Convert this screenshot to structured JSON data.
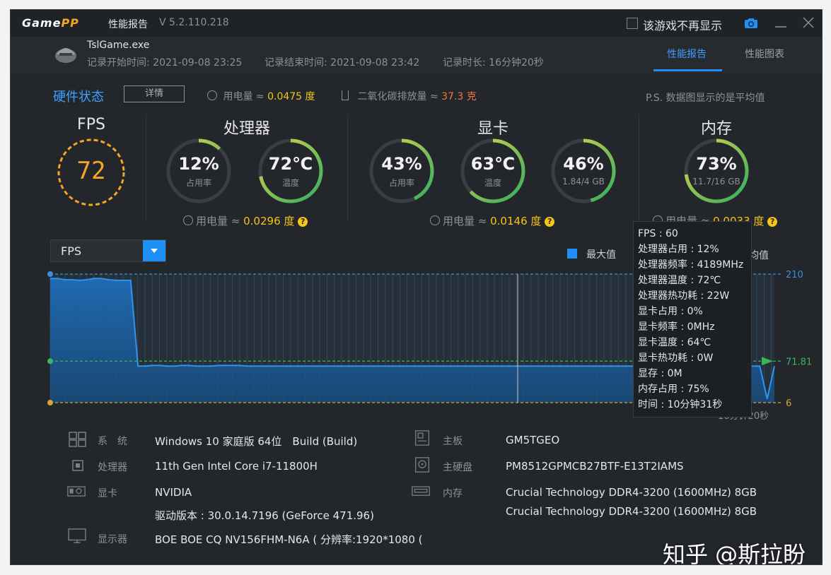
{
  "titlebar": {
    "logo_main": "Game",
    "logo_accent": "PP",
    "title": "性能报告",
    "version": "V 5.2.110.218",
    "no_show_label": "该游戏不再显示"
  },
  "session": {
    "game": "TslGame.exe",
    "start": "记录开始时间: 2021-09-08 23:25",
    "end": "记录结束时间: 2021-09-08 23:42",
    "duration": "记录时长: 16分钟20秒"
  },
  "tabs": [
    "性能报告",
    "性能图表"
  ],
  "hardware": {
    "title": "硬件状态",
    "detail_button": "详情",
    "power_label": "用电量 ≈",
    "power_value": "0.0475 度",
    "co2_label": "二氧化碳排放量 ≈",
    "co2_value": "37.3 克",
    "note": "P.S. 数据图显示的是平均值"
  },
  "sections": {
    "fps": {
      "title": "FPS",
      "value": "72"
    },
    "cpu": {
      "title": "处理器",
      "usage": {
        "value": "12%",
        "label": "占用率",
        "fraction": 0.12
      },
      "temp": {
        "value": "72℃",
        "label": "温度",
        "fraction": 0.72
      },
      "power_label": "用电量 ≈",
      "power_value": "0.0296 度"
    },
    "gpu": {
      "title": "显卡",
      "usage": {
        "value": "43%",
        "label": "占用率",
        "fraction": 0.43
      },
      "temp": {
        "value": "63℃",
        "label": "温度",
        "fraction": 0.63
      },
      "vram": {
        "value": "46%",
        "label": "1.84/4 GB",
        "fraction": 0.46
      },
      "power_label": "用电量 ≈",
      "power_value": "0.0146 度"
    },
    "mem": {
      "title": "内存",
      "usage": {
        "value": "73%",
        "label": "11.7/16 GB",
        "fraction": 0.73
      },
      "power_label": "用电量 ≈",
      "power_value": "0.0033 度"
    }
  },
  "chart_controls": {
    "metric": "FPS",
    "legend_max": "最大值",
    "legend_avg": "均值"
  },
  "chart_data": {
    "type": "area",
    "series": [
      {
        "name": "FPS",
        "values": [
          203,
          203,
          201,
          201,
          200,
          201,
          203,
          203,
          201,
          200,
          200,
          200,
          64,
          64,
          65,
          65,
          64,
          64,
          65,
          65,
          64,
          64,
          64,
          65,
          65,
          65,
          65,
          64,
          64,
          64,
          64,
          64,
          64,
          64,
          64,
          64,
          64,
          64,
          64,
          64,
          64,
          64,
          64,
          64,
          64,
          64,
          64,
          64,
          64,
          64,
          64,
          64,
          64,
          64,
          64,
          64,
          64,
          64,
          64,
          64,
          64,
          64,
          64,
          64,
          64,
          64,
          64,
          64,
          64,
          64,
          64,
          64,
          64,
          64,
          64,
          64,
          64,
          64,
          64,
          64,
          64,
          64,
          64,
          64,
          64,
          64,
          64,
          64,
          64,
          64,
          64,
          64,
          64,
          64,
          64,
          64,
          64,
          64,
          12,
          64
        ]
      }
    ],
    "ylim": [
      6,
      210
    ],
    "reference_lines": {
      "max": 210,
      "avg": 71.81,
      "min": 6
    },
    "labels": {
      "max": "210",
      "avg": "71.81",
      "min": "6"
    },
    "time_label": "16分钟20秒",
    "grid": true
  },
  "tooltip": [
    "FPS : 60",
    "处理器占用 : 12%",
    "处理器频率 : 4189MHz",
    "处理器温度 : 72℃",
    "处理器热功耗 : 22W",
    "显卡占用 : 0%",
    "显卡频率 : 0MHz",
    "显卡温度 : 64℃",
    "显卡热功耗 : 0W",
    "显存 : 0M",
    "内存占用 : 75%",
    "时间 : 10分钟31秒"
  ],
  "system": {
    "os_label": "系　统",
    "os_value": "Windows 10 家庭版 64位　Build (Build)",
    "cpu_label": "处理器",
    "cpu_value": "11th Gen Intel Core i7-11800H",
    "gpu_label": "显卡",
    "gpu_value": "NVIDIA",
    "driver_value": "驱动版本 : 30.0.14.7196 (GeForce 471.96)",
    "monitor_label": "显示器",
    "monitor_value": "BOE BOE CQ NV156FHM-N6A ( 分辨率:1920*1080 (",
    "board_label": "主板",
    "board_value": "GM5TGEO",
    "disk_label": "主硬盘",
    "disk_value": "PM8512GPMCB27BTF-E13T2IAMS",
    "ram_label": "内存",
    "ram_values": [
      "Crucial Technology DDR4-3200 (1600MHz) 8GB",
      "Crucial Technology DDR4-3200 (1600MHz) 8GB"
    ]
  },
  "watermark": "知乎 @斯拉盼"
}
